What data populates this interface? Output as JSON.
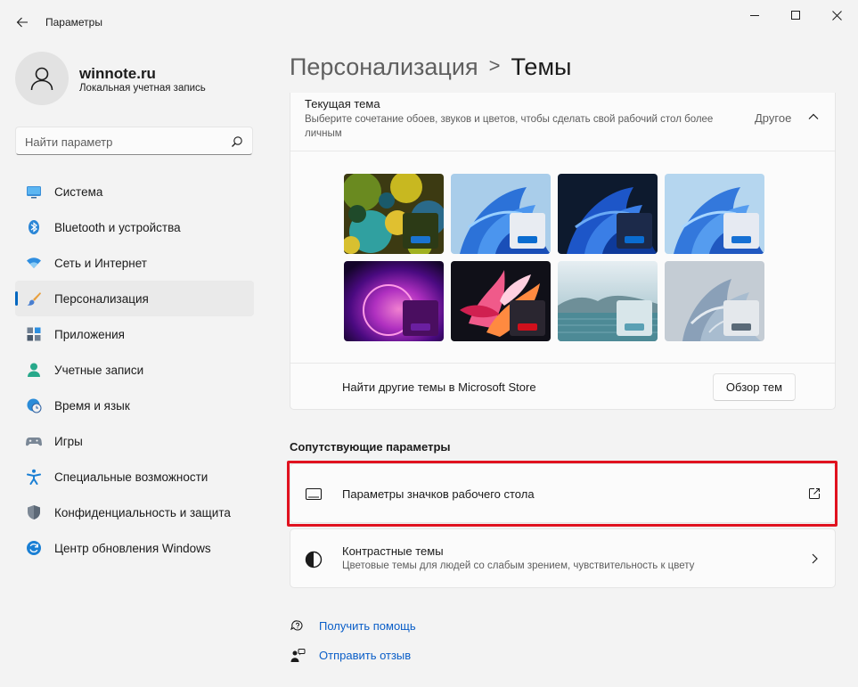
{
  "window": {
    "title": "Параметры",
    "controls": {
      "minimize": "minimize-icon",
      "maximize": "maximize-icon",
      "close": "close-icon"
    }
  },
  "user": {
    "name": "winnote.ru",
    "account_type": "Локальная учетная запись"
  },
  "search": {
    "placeholder": "Найти параметр",
    "value": ""
  },
  "sidebar": {
    "items": [
      {
        "label": "Система",
        "icon": "monitor-icon",
        "active": false
      },
      {
        "label": "Bluetooth и устройства",
        "icon": "bluetooth-icon",
        "active": false
      },
      {
        "label": "Сеть и Интернет",
        "icon": "wifi-icon",
        "active": false
      },
      {
        "label": "Персонализация",
        "icon": "brush-icon",
        "active": true
      },
      {
        "label": "Приложения",
        "icon": "apps-icon",
        "active": false
      },
      {
        "label": "Учетные записи",
        "icon": "person-icon",
        "active": false
      },
      {
        "label": "Время и язык",
        "icon": "globe-clock-icon",
        "active": false
      },
      {
        "label": "Игры",
        "icon": "gamepad-icon",
        "active": false
      },
      {
        "label": "Специальные возможности",
        "icon": "accessibility-icon",
        "active": false
      },
      {
        "label": "Конфиденциальность и защита",
        "icon": "shield-icon",
        "active": false
      },
      {
        "label": "Центр обновления Windows",
        "icon": "update-icon",
        "active": false
      }
    ]
  },
  "breadcrumb": {
    "parent": "Персонализация",
    "separator": ">",
    "current": "Темы"
  },
  "current_theme": {
    "title": "Текущая тема",
    "description": "Выберите сочетание обоев, звуков и цветов, чтобы сделать свой рабочий стол более личным",
    "value": "Другое",
    "themes": [
      {
        "name": "fractal-theme",
        "accent": "#1a73d0",
        "mini_bg": "#2c3a16"
      },
      {
        "name": "windows-light-theme",
        "accent": "#0a6cd0",
        "mini_bg": "#e8ecf2"
      },
      {
        "name": "windows-dark-theme",
        "accent": "#0a6cd0",
        "mini_bg": "#1c2a4a"
      },
      {
        "name": "windows-light-alt-theme",
        "accent": "#1670d4",
        "mini_bg": "#e6eaf2"
      },
      {
        "name": "glow-theme",
        "accent": "#6a1fa0",
        "mini_bg": "#4a0e60"
      },
      {
        "name": "captured-motion-theme",
        "accent": "#d0101c",
        "mini_bg": "#2a2630"
      },
      {
        "name": "sunrise-theme",
        "accent": "#5aa0b4",
        "mini_bg": "#d8e6ea"
      },
      {
        "name": "flow-theme",
        "accent": "#5a6a78",
        "mini_bg": "#e4e8ec"
      }
    ],
    "store_text": "Найти другие темы в Microsoft Store",
    "browse_button": "Обзор тем"
  },
  "related": {
    "title": "Сопутствующие параметры",
    "desktop_icons": {
      "title": "Параметры значков рабочего стола",
      "icon": "monitor-outline-icon",
      "end_icon": "external-link-icon"
    },
    "contrast": {
      "title": "Контрастные темы",
      "subtitle": "Цветовые темы для людей со слабым зрением, чувствительность к цвету",
      "icon": "contrast-icon",
      "end_icon": "chevron-right-icon"
    }
  },
  "links": {
    "help": "Получить помощь",
    "feedback": "Отправить отзыв"
  },
  "colors": {
    "accent": "#0067c0",
    "highlight": "#e0121f",
    "link": "#0a5ec8"
  }
}
